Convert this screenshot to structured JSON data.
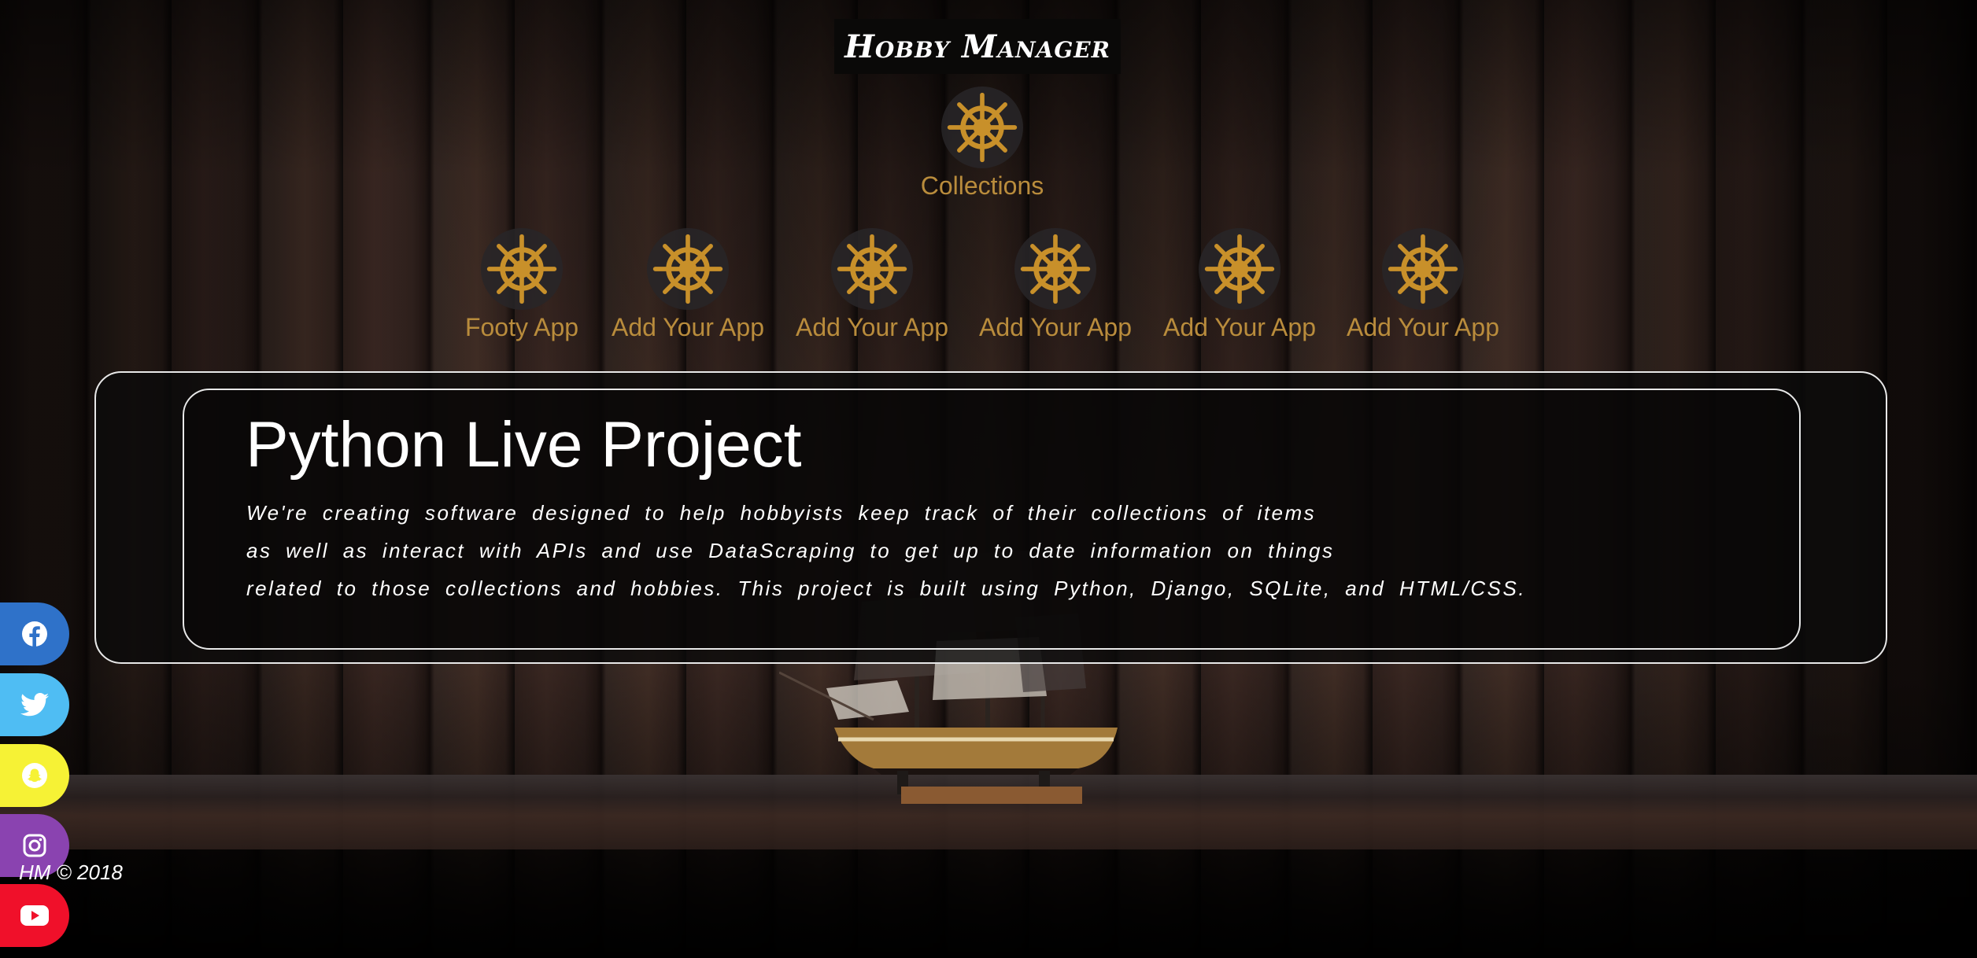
{
  "header": {
    "brand": "Hobby Manager"
  },
  "nav": {
    "collections_label": "Collections",
    "apps": [
      {
        "label": "Footy App"
      },
      {
        "label": "Add Your App"
      },
      {
        "label": "Add Your App"
      },
      {
        "label": "Add Your App"
      },
      {
        "label": "Add Your App"
      },
      {
        "label": "Add Your App"
      }
    ],
    "icon": "ship-wheel-icon",
    "icon_color": "#c8902a",
    "label_color": "#b98c3c"
  },
  "intro": {
    "title": "Python Live Project",
    "lines": [
      "We're creating software designed to help hobbyists keep track of their collections of items",
      "as well as interact with APIs and use DataScraping to get up to date information on things",
      "related to those collections and hobbies. This project is built using Python, Django, SQLite, and HTML/CSS."
    ]
  },
  "social": [
    {
      "name": "facebook",
      "icon": "facebook-icon",
      "color": "#2f72c9"
    },
    {
      "name": "twitter",
      "icon": "twitter-icon",
      "color": "#4fbdf3"
    },
    {
      "name": "snapchat",
      "icon": "snapchat-icon",
      "color": "#f6f235"
    },
    {
      "name": "instagram",
      "icon": "instagram-icon",
      "color": "#8a43b0"
    },
    {
      "name": "youtube",
      "icon": "youtube-icon",
      "color": "#f0102a"
    }
  ],
  "footer": {
    "text": "HM © 2018"
  }
}
